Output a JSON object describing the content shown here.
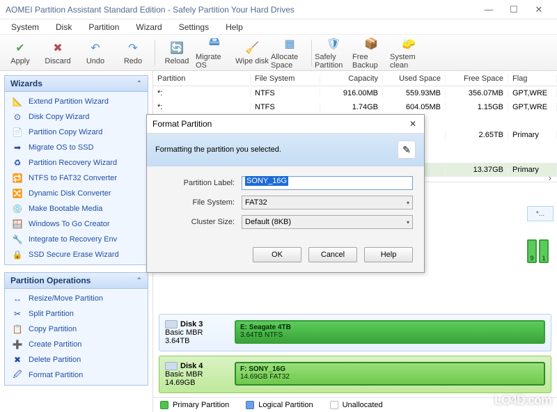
{
  "window": {
    "title": "AOMEI Partition Assistant Standard Edition - Safely Partition Your Hard Drives"
  },
  "menu": [
    "System",
    "Disk",
    "Partition",
    "Wizard",
    "Settings",
    "Help"
  ],
  "toolbar": [
    {
      "icon": "✔",
      "label": "Apply",
      "color": "#5aa35a"
    },
    {
      "icon": "✖",
      "label": "Discard",
      "color": "#b05050"
    },
    {
      "icon": "↶",
      "label": "Undo",
      "color": "#4b8fd0"
    },
    {
      "icon": "↷",
      "label": "Redo",
      "color": "#4b8fd0"
    },
    {
      "sep": true
    },
    {
      "icon": "🔄",
      "label": "Reload",
      "color": "#4b8fd0"
    },
    {
      "icon": "🖴",
      "label": "Migrate OS",
      "color": "#4b8fd0"
    },
    {
      "icon": "🧹",
      "label": "Wipe disk",
      "color": "#4b8fd0"
    },
    {
      "icon": "▦",
      "label": "Allocate Space",
      "color": "#4b8fd0"
    },
    {
      "sep": true
    },
    {
      "icon": "🛡",
      "label": "Safely Partition",
      "color": "#4b8fd0"
    },
    {
      "icon": "📦",
      "label": "Free Backup",
      "color": "#4b8fd0"
    },
    {
      "icon": "🧽",
      "label": "System clean",
      "color": "#4b8fd0"
    }
  ],
  "wizards": {
    "title": "Wizards",
    "items": [
      {
        "icon": "📐",
        "label": "Extend Partition Wizard"
      },
      {
        "icon": "⊙",
        "label": "Disk Copy Wizard"
      },
      {
        "icon": "📄",
        "label": "Partition Copy Wizard"
      },
      {
        "icon": "➡",
        "label": "Migrate OS to SSD"
      },
      {
        "icon": "♻",
        "label": "Partition Recovery Wizard"
      },
      {
        "icon": "🔁",
        "label": "NTFS to FAT32 Converter"
      },
      {
        "icon": "🔀",
        "label": "Dynamic Disk Converter"
      },
      {
        "icon": "💿",
        "label": "Make Bootable Media"
      },
      {
        "icon": "🪟",
        "label": "Windows To Go Creator"
      },
      {
        "icon": "🔧",
        "label": "Integrate to Recovery Env"
      },
      {
        "icon": "🔒",
        "label": "SSD Secure Erase Wizard"
      }
    ]
  },
  "ops": {
    "title": "Partition Operations",
    "items": [
      {
        "icon": "↔",
        "label": "Resize/Move Partition"
      },
      {
        "icon": "✂",
        "label": "Split Partition"
      },
      {
        "icon": "📋",
        "label": "Copy Partition"
      },
      {
        "icon": "➕",
        "label": "Create Partition"
      },
      {
        "icon": "✖",
        "label": "Delete Partition"
      },
      {
        "icon": "🖉",
        "label": "Format Partition"
      }
    ]
  },
  "table": {
    "headers": [
      "Partition",
      "File System",
      "Capacity",
      "Used Space",
      "Free Space",
      "Flag"
    ],
    "rows": [
      {
        "p": "*:",
        "fs": "NTFS",
        "cap": "916.00MB",
        "used": "559.93MB",
        "free": "356.07MB",
        "flag": "GPT,WRE"
      },
      {
        "p": "*:",
        "fs": "NTFS",
        "cap": "1.74GB",
        "used": "604.05MB",
        "free": "1.15GB",
        "flag": "GPT,WRE"
      }
    ],
    "extra1": {
      "free": "2.65TB",
      "flag": "Primary"
    },
    "extra2": {
      "free": "13.37GB",
      "flag": "Primary"
    },
    "diskhdr": "Disk 3"
  },
  "disks": [
    {
      "name": "Disk 3",
      "type": "Basic MBR",
      "size": "3.64TB",
      "vol": "E: Seagate 4TB",
      "detail": "3.64TB NTFS"
    },
    {
      "name": "Disk 4",
      "type": "Basic MBR",
      "size": "14.69GB",
      "vol": "F: SONY_16G",
      "detail": "14.69GB FAT32",
      "sel": true
    }
  ],
  "legend": {
    "p": "Primary Partition",
    "l": "Logical Partition",
    "u": "Unallocated"
  },
  "dialog": {
    "title": "Format Partition",
    "desc": "Formatting the partition you selected.",
    "fields": {
      "label_lbl": "Partition Label:",
      "label_val": "SONY_16G",
      "fs_lbl": "File System:",
      "fs_val": "FAT32",
      "cs_lbl": "Cluster Size:",
      "cs_val": "Default (8KB)"
    },
    "buttons": {
      "ok": "OK",
      "cancel": "Cancel",
      "help": "Help"
    }
  },
  "side": {
    "star": "*...",
    "n9": "9",
    "n1": "1"
  },
  "watermark": "LO4D.com"
}
